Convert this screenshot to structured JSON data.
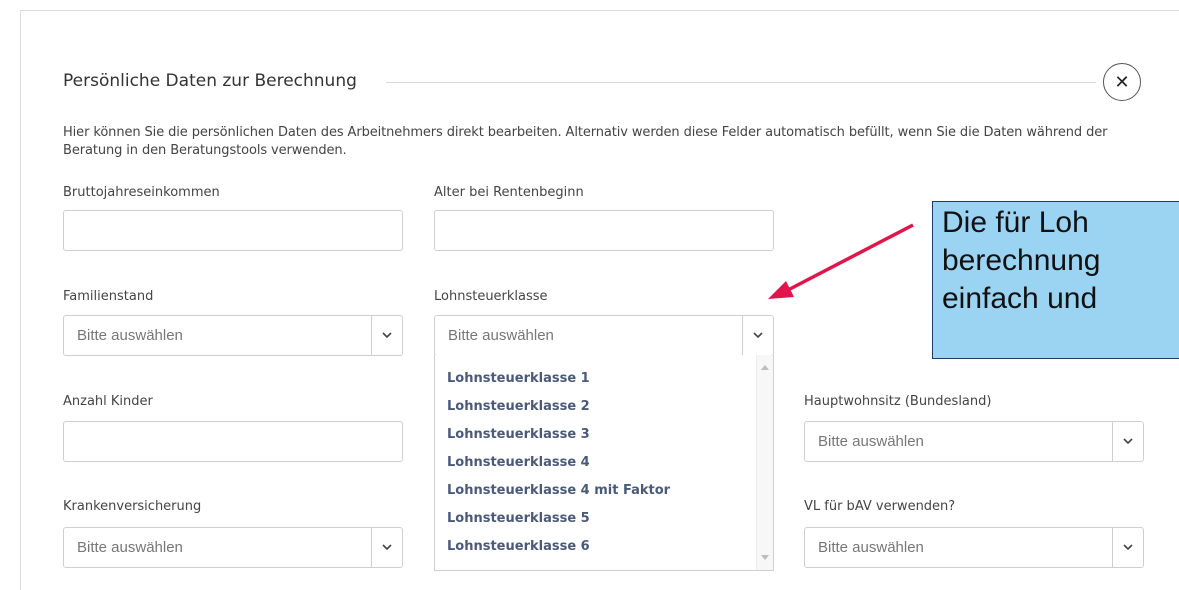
{
  "dialog": {
    "title": "Persönliche Daten zur Berechnung",
    "close_icon": "close-icon",
    "description": "Hier können Sie die persönlichen Daten des Arbeitnehmers direkt bearbeiten. Alternativ werden diese Felder automatisch befüllt, wenn Sie die Daten während der Beratung in den Beratungstools verwenden."
  },
  "fields": {
    "bruttojahreseinkommen": {
      "label": "Bruttojahreseinkommen",
      "value": ""
    },
    "alter": {
      "label": "Alter bei Rentenbeginn",
      "value": ""
    },
    "familienstand": {
      "label": "Familienstand",
      "placeholder": "Bitte auswählen"
    },
    "lohnsteuerklasse": {
      "label": "Lohnsteuerklasse",
      "placeholder": "Bitte auswählen"
    },
    "anzahl_kinder": {
      "label": "Anzahl Kinder",
      "value": ""
    },
    "hauptwohnsitz": {
      "label": "Hauptwohnsitz (Bundesland)",
      "placeholder": "Bitte auswählen"
    },
    "krankenversicherung": {
      "label": "Krankenversicherung",
      "placeholder": "Bitte auswählen"
    },
    "vl_bav": {
      "label": "VL für bAV verwenden?",
      "placeholder": "Bitte auswählen"
    }
  },
  "lohnsteuer_options": [
    "Lohnsteuerklasse 1",
    "Lohnsteuerklasse 2",
    "Lohnsteuerklasse 3",
    "Lohnsteuerklasse 4",
    "Lohnsteuerklasse 4 mit Faktor",
    "Lohnsteuerklasse 5",
    "Lohnsteuerklasse 6"
  ],
  "callout": {
    "lines": [
      "Die für Loh",
      "berechnung",
      "einfach und"
    ],
    "background": "#9bd3f3",
    "arrow_color": "#e0164a"
  }
}
